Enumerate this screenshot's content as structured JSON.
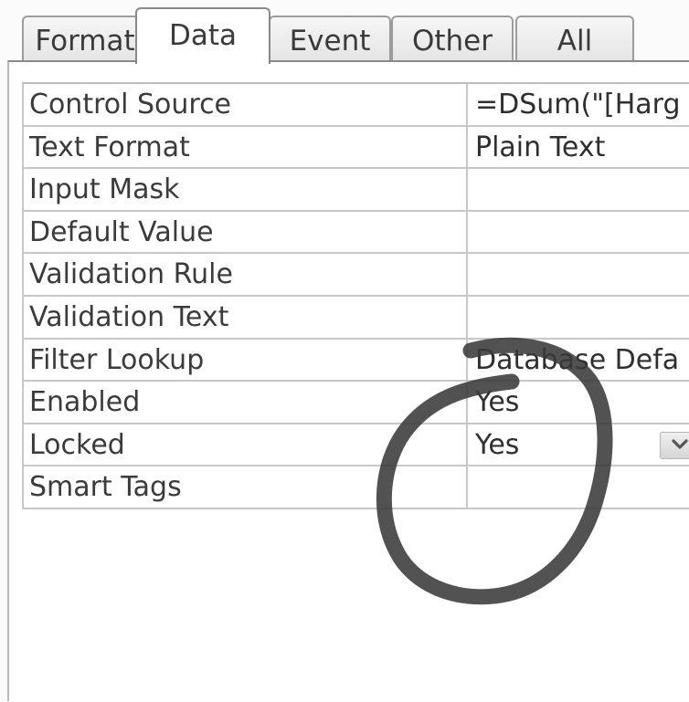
{
  "tabs": [
    {
      "label": "Format",
      "active": false
    },
    {
      "label": "Data",
      "active": true
    },
    {
      "label": "Event",
      "active": false
    },
    {
      "label": "Other",
      "active": false
    },
    {
      "label": "All",
      "active": false
    }
  ],
  "properties": [
    {
      "name": "Control Source",
      "value": "=DSum(\"[Harg"
    },
    {
      "name": "Text Format",
      "value": "Plain Text"
    },
    {
      "name": "Input Mask",
      "value": ""
    },
    {
      "name": "Default Value",
      "value": ""
    },
    {
      "name": "Validation Rule",
      "value": ""
    },
    {
      "name": "Validation Text",
      "value": ""
    },
    {
      "name": "Filter Lookup",
      "value": "Database Defa"
    },
    {
      "name": "Enabled",
      "value": "Yes"
    },
    {
      "name": "Locked",
      "value": "Yes"
    },
    {
      "name": "Smart Tags",
      "value": ""
    }
  ],
  "icons": {
    "dropdown": "chevron-down-icon"
  },
  "colors": {
    "annotation_stroke": "#3a3a3a",
    "grid_line": "#c7c7c7"
  }
}
